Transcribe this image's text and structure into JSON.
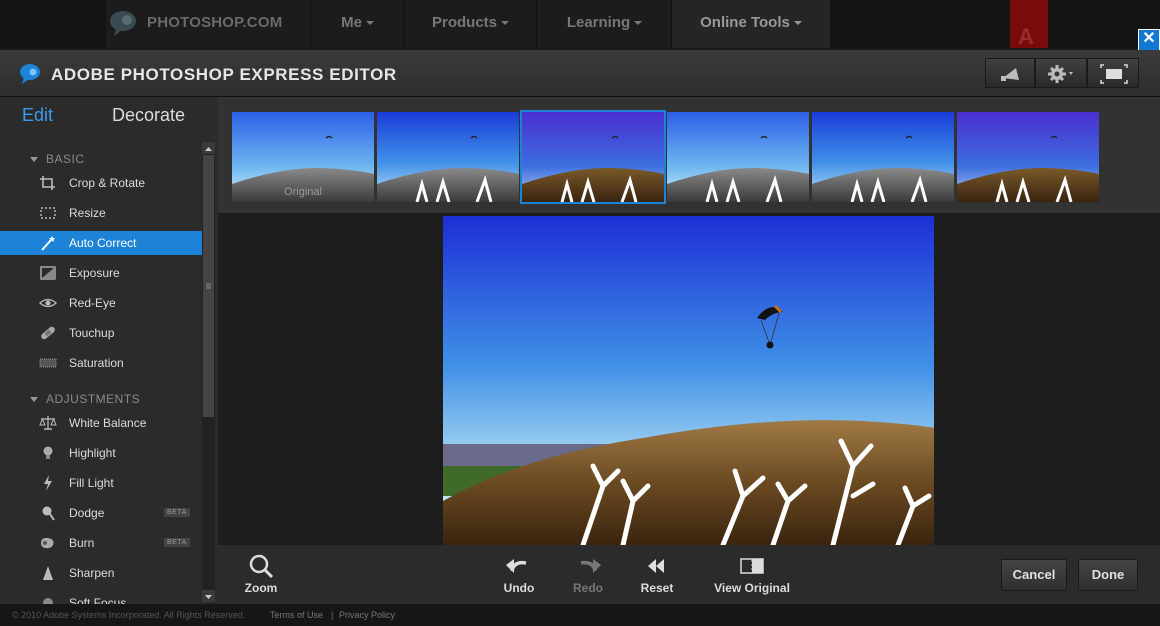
{
  "site_nav": {
    "logo_text": "PHOTOSHOP.COM",
    "items": [
      {
        "label": "Me"
      },
      {
        "label": "Products"
      },
      {
        "label": "Learning"
      },
      {
        "label": "Online Tools"
      }
    ],
    "adobe_logo": "A"
  },
  "editor": {
    "title": "ADOBE PHOTOSHOP EXPRESS EDITOR",
    "tabs": {
      "edit": "Edit",
      "decorate": "Decorate"
    },
    "accent_color": "#1c83d6"
  },
  "sections": {
    "basic": "BASIC",
    "adjustments": "ADJUSTMENTS"
  },
  "basic_tools": [
    {
      "label": "Crop & Rotate",
      "icon": "crop-icon"
    },
    {
      "label": "Resize",
      "icon": "resize-icon"
    },
    {
      "label": "Auto Correct",
      "icon": "magic-wand-icon",
      "selected": true
    },
    {
      "label": "Exposure",
      "icon": "exposure-icon"
    },
    {
      "label": "Red-Eye",
      "icon": "eye-icon"
    },
    {
      "label": "Touchup",
      "icon": "bandage-icon"
    },
    {
      "label": "Saturation",
      "icon": "saturation-icon"
    }
  ],
  "adjustment_tools": [
    {
      "label": "White Balance",
      "icon": "scale-icon"
    },
    {
      "label": "Highlight",
      "icon": "bulb-icon"
    },
    {
      "label": "Fill Light",
      "icon": "lightning-icon"
    },
    {
      "label": "Dodge",
      "icon": "dodge-icon",
      "badge": "BETA"
    },
    {
      "label": "Burn",
      "icon": "burn-icon",
      "badge": "BETA"
    },
    {
      "label": "Sharpen",
      "icon": "sharpen-icon"
    },
    {
      "label": "Soft Focus",
      "icon": "soft-focus-icon"
    }
  ],
  "thumbnails": [
    {
      "caption": "Original"
    },
    {
      "caption": ""
    },
    {
      "caption": "",
      "selected": true
    },
    {
      "caption": ""
    },
    {
      "caption": ""
    },
    {
      "caption": ""
    }
  ],
  "bottom_toolbar": {
    "zoom": "Zoom",
    "undo": "Undo",
    "redo": "Redo",
    "reset": "Reset",
    "view_original": "View Original",
    "cancel": "Cancel",
    "done": "Done"
  },
  "footer": {
    "copyright": "© 2010 Adobe Systems Incorporated. All Rights Reserved.",
    "terms": "Terms of Use",
    "separator": "|",
    "privacy": "Privacy Policy"
  }
}
